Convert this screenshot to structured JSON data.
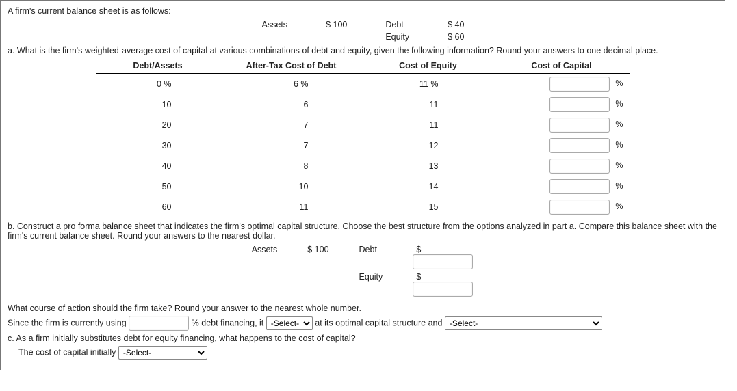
{
  "intro": "A firm's current balance sheet is as follows:",
  "balance_sheet": {
    "assets_label": "Assets",
    "assets_value": "$ 100",
    "debt_label": "Debt",
    "debt_value": "$ 40",
    "equity_label": "Equity",
    "equity_value": "$ 60"
  },
  "part_a": {
    "question": "a. What is the firm's weighted-average cost of capital at various combinations of debt and equity, given the following information? Round your answers to one decimal place.",
    "headers": {
      "col1": "Debt/Assets",
      "col2": "After-Tax Cost of Debt",
      "col3": "Cost of Equity",
      "col4": "Cost of Capital"
    },
    "rows": [
      {
        "da": "0 %",
        "cd": "6 %",
        "ce": "11 %"
      },
      {
        "da": "10",
        "cd": "6",
        "ce": "11"
      },
      {
        "da": "20",
        "cd": "7",
        "ce": "11"
      },
      {
        "da": "30",
        "cd": "7",
        "ce": "12"
      },
      {
        "da": "40",
        "cd": "8",
        "ce": "13"
      },
      {
        "da": "50",
        "cd": "10",
        "ce": "14"
      },
      {
        "da": "60",
        "cd": "11",
        "ce": "15"
      }
    ],
    "pct_symbol": "%"
  },
  "part_b": {
    "question": "b. Construct a pro forma balance sheet that indicates the firm's optimal capital structure. Choose the best structure from the options analyzed in part a. Compare this balance sheet with the firm's current balance sheet. Round your answers to the nearest dollar.",
    "assets_label": "Assets",
    "assets_value": "$ 100",
    "debt_label": "Debt",
    "equity_label": "Equity",
    "dollar": "$",
    "followup": "What course of action should the firm take? Round your answer to the nearest whole number.",
    "sentence_pre": "Since the firm is currently using",
    "sentence_mid": "% debt financing, it",
    "sentence_post": "at its optimal capital structure and",
    "select_placeholder": "-Select-"
  },
  "part_c": {
    "question": "c. As a firm initially substitutes debt for equity financing, what happens to the cost of capital?",
    "sentence_pre": "The cost of capital initially",
    "select_placeholder": "-Select-"
  }
}
